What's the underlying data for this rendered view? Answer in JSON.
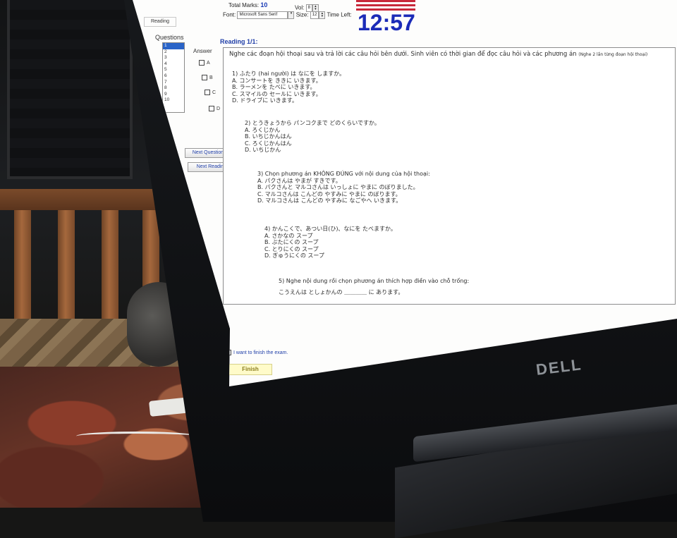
{
  "header": {
    "total_marks_label": "Total Marks:",
    "total_marks_value": "10",
    "vol_label": "Vol:",
    "vol_value": "8",
    "font_label": "Font:",
    "font_value": "Microsoft Sans Serif",
    "size_label": "Size:",
    "size_value": "12",
    "time_left_label": "Time Left:",
    "timer": "12:57"
  },
  "tab": {
    "reading": "Reading"
  },
  "questions": {
    "label": "Questions",
    "items": [
      "1",
      "2",
      "3",
      "4",
      "5",
      "6",
      "7",
      "8",
      "9",
      "10"
    ],
    "selected": "1"
  },
  "answer": {
    "label": "Answer",
    "options": [
      "A",
      "B",
      "C",
      "D"
    ]
  },
  "buttons": {
    "next_question": "Next Question",
    "next_reading": "Next Reading",
    "finish": "Finish"
  },
  "reading": {
    "title": "Reading 1/1:",
    "intro": "Nghe các đoạn hội thoại sau và trả lời các câu hỏi bên dưới. Sinh viên có thời gian để đọc câu hỏi và các phương án",
    "intro_note": "(Nghe 2 lần từng đoạn hội thoại)",
    "items": [
      {
        "q": "1) ふたり (hai người) は なにを しますか。",
        "a": [
          "A. コンサートを ききに いきます。",
          "B. ラーメンを たべに いきます。",
          "C. スマイルの セールに いきます。",
          "D. ドライブに いきます。"
        ]
      },
      {
        "q": "2) とうきょうから パンコクまで どのくらいですか。",
        "a": [
          "A. ろくじかん",
          "B. いちじかんはん",
          "C. ろくじかんはん",
          "D. いちじかん"
        ]
      },
      {
        "q": "3) Chọn phương án KHÔNG ĐÚNG với nội dung của hội thoại:",
        "a": [
          "A. パクさんは やまが すきです。",
          "B. パクさんと マルコさんは いっしょに やまに のぼりました。",
          "C. マルコさんは こんどの やすみに やまに のぼります。",
          "D. マルコさんは こんどの やすみに なごやへ いきます。"
        ]
      },
      {
        "q": "4) かんこくで、あつい日(ひ)、なにを たべますか。",
        "a": [
          "A. さかなの スープ",
          "B. ぶたにくの スープ",
          "C. とりにくの スープ",
          "D. ぎゅうにくの スープ"
        ]
      },
      {
        "q": "5) Nghe nội dung rồi chọn phương án thích hợp điền vào chỗ trống:",
        "a": [
          "こうえんは としょかんの ＿＿＿＿ に あります。"
        ]
      }
    ]
  },
  "footer": {
    "finish_checkbox_label": "I want to finish the exam."
  },
  "laptop": {
    "brand": "DELL"
  },
  "colors": {
    "timer": "#1b2bb8",
    "link_blue": "#1f3ea8",
    "finish_bg": "#fffbc9"
  }
}
